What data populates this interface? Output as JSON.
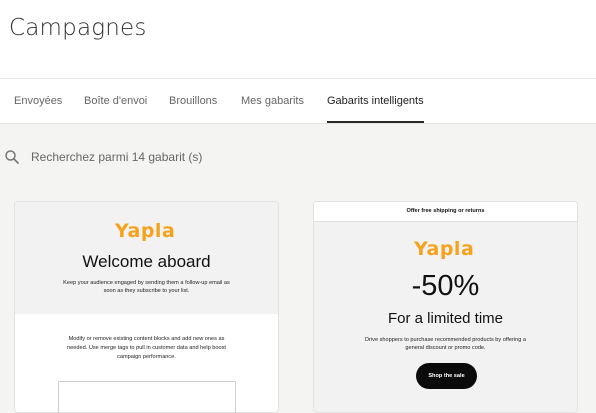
{
  "header": {
    "title": "Campagnes"
  },
  "tabs": [
    {
      "label": "Envoyées",
      "active": false
    },
    {
      "label": "Boîte d'envoi",
      "active": false
    },
    {
      "label": "Brouillons",
      "active": false
    },
    {
      "label": "Mes gabarits",
      "active": false
    },
    {
      "label": "Gabarits intelligents",
      "active": true
    }
  ],
  "search": {
    "icon": "search-icon",
    "text": "Recherchez parmi  14 gabarit (s)"
  },
  "templates": [
    {
      "logo": "Yapla",
      "title": "Welcome aboard",
      "intro_line1": "Keep your audience engaged by sending them a follow-up email as",
      "intro_line2": "soon as they subscribe to your list.",
      "body_line1": "Modify or remove existing content blocks and add new ones as",
      "body_line2": "needed. Use merge tags to pull in customer data and help boost",
      "body_line3": "campaign performance."
    },
    {
      "banner": "Offer free shipping or returns",
      "logo": "Yapla",
      "headline": "-50%",
      "subheadline": "For a limited time",
      "body_line1": "Drive shoppers to purchase recommended products by offering a",
      "body_line2": "general discount or promo code.",
      "button": "Shop the sale"
    }
  ],
  "colors": {
    "brand_logo": "#f6a21c",
    "button_bg": "#0b0b0b",
    "page_bg": "#f4f4f3"
  }
}
